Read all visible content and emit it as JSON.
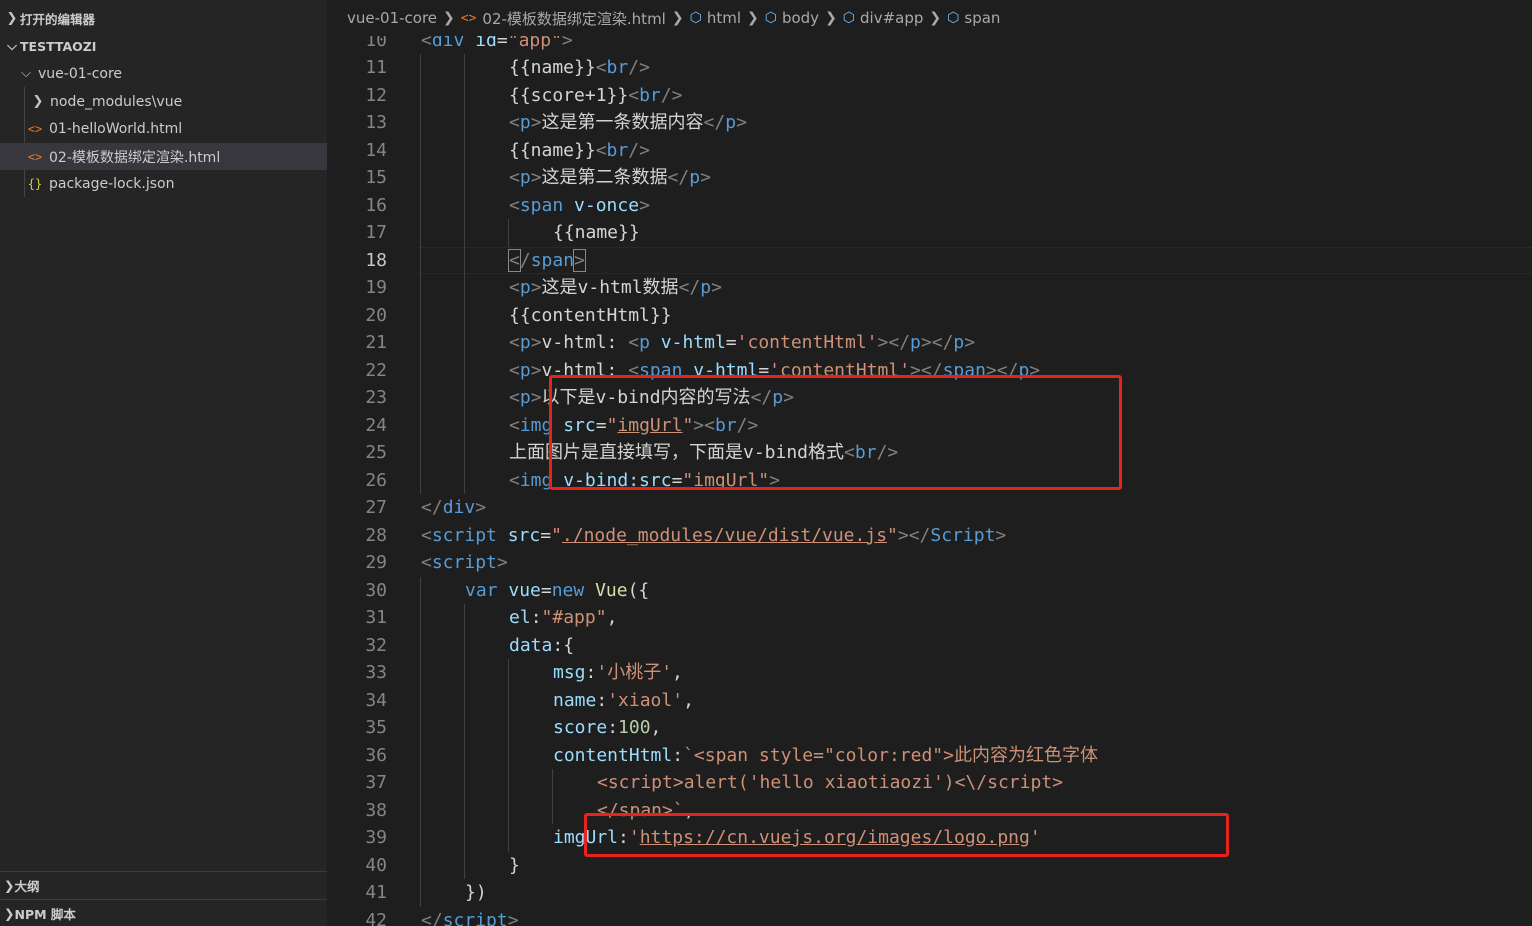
{
  "sidebar": {
    "open_editors": "打开的编辑器",
    "project": "TESTTAOZI",
    "folder": "vue-01-core",
    "items": [
      {
        "label": "node_modules\\vue",
        "type": "folder"
      },
      {
        "label": "01-helloWorld.html",
        "type": "html"
      },
      {
        "label": "02-模板数据绑定渲染.html",
        "type": "html"
      },
      {
        "label": "package-lock.json",
        "type": "json"
      }
    ],
    "outline": "大纲",
    "npm": "NPM 脚本"
  },
  "breadcrumb": {
    "items": [
      "vue-01-core",
      "02-模板数据绑定渲染.html",
      "html",
      "body",
      "div#app",
      "span"
    ]
  },
  "editor": {
    "active_line": 18,
    "lines": [
      {
        "n": 10,
        "indent": 1,
        "tokens": [
          [
            "br",
            "<"
          ],
          [
            "tag",
            "div"
          ],
          [
            "txt",
            " "
          ],
          [
            "attr",
            "id"
          ],
          [
            "txt",
            "="
          ],
          [
            "str",
            "\"app\""
          ],
          [
            "br",
            ">"
          ]
        ]
      },
      {
        "n": 11,
        "indent": 3,
        "tokens": [
          [
            "txt",
            "{{name}}"
          ],
          [
            "br",
            "<"
          ],
          [
            "tag",
            "br"
          ],
          [
            "br",
            "/>"
          ]
        ]
      },
      {
        "n": 12,
        "indent": 3,
        "tokens": [
          [
            "txt",
            "{{score+1}}"
          ],
          [
            "br",
            "<"
          ],
          [
            "tag",
            "br"
          ],
          [
            "br",
            "/>"
          ]
        ]
      },
      {
        "n": 13,
        "indent": 3,
        "tokens": [
          [
            "br",
            "<"
          ],
          [
            "tag",
            "p"
          ],
          [
            "br",
            ">"
          ],
          [
            "txt",
            "这是第一条数据内容"
          ],
          [
            "br",
            "</"
          ],
          [
            "tag",
            "p"
          ],
          [
            "br",
            ">"
          ]
        ]
      },
      {
        "n": 14,
        "indent": 3,
        "tokens": [
          [
            "txt",
            "{{name}}"
          ],
          [
            "br",
            "<"
          ],
          [
            "tag",
            "br"
          ],
          [
            "br",
            "/>"
          ]
        ]
      },
      {
        "n": 15,
        "indent": 3,
        "tokens": [
          [
            "br",
            "<"
          ],
          [
            "tag",
            "p"
          ],
          [
            "br",
            ">"
          ],
          [
            "txt",
            "这是第二条数据"
          ],
          [
            "br",
            "</"
          ],
          [
            "tag",
            "p"
          ],
          [
            "br",
            ">"
          ]
        ]
      },
      {
        "n": 16,
        "indent": 3,
        "tokens": [
          [
            "br",
            "<"
          ],
          [
            "tag",
            "span"
          ],
          [
            "txt",
            " "
          ],
          [
            "attr",
            "v-once"
          ],
          [
            "br",
            ">"
          ]
        ]
      },
      {
        "n": 17,
        "indent": 4,
        "tokens": [
          [
            "txt",
            "{{name}}"
          ]
        ]
      },
      {
        "n": 18,
        "indent": 3,
        "tokens": [
          [
            "brm",
            "<"
          ],
          [
            "br",
            "/"
          ],
          [
            "tag",
            "span"
          ],
          [
            "brm",
            ">"
          ]
        ]
      },
      {
        "n": 19,
        "indent": 3,
        "tokens": [
          [
            "br",
            "<"
          ],
          [
            "tag",
            "p"
          ],
          [
            "br",
            ">"
          ],
          [
            "txt",
            "这是v-html数据"
          ],
          [
            "br",
            "</"
          ],
          [
            "tag",
            "p"
          ],
          [
            "br",
            ">"
          ]
        ]
      },
      {
        "n": 20,
        "indent": 3,
        "tokens": [
          [
            "txt",
            "{{contentHtml}}"
          ]
        ]
      },
      {
        "n": 21,
        "indent": 3,
        "tokens": [
          [
            "br",
            "<"
          ],
          [
            "tag",
            "p"
          ],
          [
            "br",
            ">"
          ],
          [
            "txt",
            "v-html: "
          ],
          [
            "br",
            "<"
          ],
          [
            "tag",
            "p"
          ],
          [
            "txt",
            " "
          ],
          [
            "attr",
            "v-html"
          ],
          [
            "txt",
            "="
          ],
          [
            "str",
            "'contentHtml'"
          ],
          [
            "br",
            "></"
          ],
          [
            "tag",
            "p"
          ],
          [
            "br",
            "></"
          ],
          [
            "tag",
            "p"
          ],
          [
            "br",
            ">"
          ]
        ]
      },
      {
        "n": 22,
        "indent": 3,
        "tokens": [
          [
            "br",
            "<"
          ],
          [
            "tag",
            "p"
          ],
          [
            "br",
            ">"
          ],
          [
            "txt",
            "v-html: "
          ],
          [
            "br",
            "<"
          ],
          [
            "tag",
            "span"
          ],
          [
            "txt",
            " "
          ],
          [
            "attr",
            "v-html"
          ],
          [
            "txt",
            "="
          ],
          [
            "str",
            "'contentHtml'"
          ],
          [
            "br",
            "></"
          ],
          [
            "tag",
            "span"
          ],
          [
            "br",
            "></"
          ],
          [
            "tag",
            "p"
          ],
          [
            "br",
            ">"
          ]
        ]
      },
      {
        "n": 23,
        "indent": 3,
        "tokens": [
          [
            "br",
            "<"
          ],
          [
            "tag",
            "p"
          ],
          [
            "br",
            ">"
          ],
          [
            "txt",
            "以下是v-bind内容的写法"
          ],
          [
            "br",
            "</"
          ],
          [
            "tag",
            "p"
          ],
          [
            "br",
            ">"
          ]
        ]
      },
      {
        "n": 24,
        "indent": 3,
        "tokens": [
          [
            "br",
            "<"
          ],
          [
            "tag",
            "img"
          ],
          [
            "txt",
            " "
          ],
          [
            "attr",
            "src"
          ],
          [
            "txt",
            "="
          ],
          [
            "str",
            "\""
          ],
          [
            "strul",
            "imgUrl"
          ],
          [
            "str",
            "\""
          ],
          [
            "br",
            "><"
          ],
          [
            "tag",
            "br"
          ],
          [
            "br",
            "/>"
          ]
        ]
      },
      {
        "n": 25,
        "indent": 3,
        "tokens": [
          [
            "txt",
            "上面图片是直接填写，下面是v-bind格式"
          ],
          [
            "br",
            "<"
          ],
          [
            "tag",
            "br"
          ],
          [
            "br",
            "/>"
          ]
        ]
      },
      {
        "n": 26,
        "indent": 3,
        "tokens": [
          [
            "br",
            "<"
          ],
          [
            "tag",
            "img"
          ],
          [
            "txt",
            " "
          ],
          [
            "attr",
            "v-bind:src"
          ],
          [
            "txt",
            "="
          ],
          [
            "str",
            "\"imgUrl\""
          ],
          [
            "br",
            ">"
          ]
        ]
      },
      {
        "n": 27,
        "indent": 1,
        "tokens": [
          [
            "br",
            "</"
          ],
          [
            "tag",
            "div"
          ],
          [
            "br",
            ">"
          ]
        ]
      },
      {
        "n": 28,
        "indent": 1,
        "tokens": [
          [
            "br",
            "<"
          ],
          [
            "tag",
            "script"
          ],
          [
            "txt",
            " "
          ],
          [
            "attr",
            "src"
          ],
          [
            "txt",
            "="
          ],
          [
            "str",
            "\""
          ],
          [
            "strul",
            "./node_modules/vue/dist/vue.js"
          ],
          [
            "str",
            "\""
          ],
          [
            "br",
            "></"
          ],
          [
            "tag",
            "Script"
          ],
          [
            "br",
            ">"
          ]
        ]
      },
      {
        "n": 29,
        "indent": 1,
        "tokens": [
          [
            "br",
            "<"
          ],
          [
            "tag",
            "script"
          ],
          [
            "br",
            ">"
          ]
        ]
      },
      {
        "n": 30,
        "indent": 2,
        "tokens": [
          [
            "kw",
            "var"
          ],
          [
            "txt",
            " "
          ],
          [
            "attr",
            "vue"
          ],
          [
            "txt",
            "="
          ],
          [
            "kw",
            "new"
          ],
          [
            "txt",
            " "
          ],
          [
            "fn",
            "Vue"
          ],
          [
            "txt",
            "({"
          ]
        ]
      },
      {
        "n": 31,
        "indent": 3,
        "tokens": [
          [
            "attr",
            "el"
          ],
          [
            "txt",
            ":"
          ],
          [
            "str",
            "\"#app\""
          ],
          [
            "txt",
            ","
          ]
        ]
      },
      {
        "n": 32,
        "indent": 3,
        "tokens": [
          [
            "attr",
            "data"
          ],
          [
            "txt",
            ":{"
          ]
        ]
      },
      {
        "n": 33,
        "indent": 4,
        "tokens": [
          [
            "attr",
            "msg"
          ],
          [
            "txt",
            ":"
          ],
          [
            "str",
            "'小桃子'"
          ],
          [
            "txt",
            ","
          ]
        ]
      },
      {
        "n": 34,
        "indent": 4,
        "tokens": [
          [
            "attr",
            "name"
          ],
          [
            "txt",
            ":"
          ],
          [
            "str",
            "'xiaol'"
          ],
          [
            "txt",
            ","
          ]
        ]
      },
      {
        "n": 35,
        "indent": 4,
        "tokens": [
          [
            "attr",
            "score"
          ],
          [
            "txt",
            ":"
          ],
          [
            "num",
            "100"
          ],
          [
            "txt",
            ","
          ]
        ]
      },
      {
        "n": 36,
        "indent": 4,
        "tokens": [
          [
            "attr",
            "contentHtml"
          ],
          [
            "txt",
            ":"
          ],
          [
            "str",
            "`<span style=\"color:red\">此内容为红色字体"
          ]
        ]
      },
      {
        "n": 37,
        "indent": 5,
        "tokens": [
          [
            "str",
            "<script>alert('hello xiaotiaozi')<\\/script>"
          ]
        ]
      },
      {
        "n": 38,
        "indent": 5,
        "tokens": [
          [
            "str",
            "</span>`"
          ],
          [
            "txt",
            ","
          ]
        ]
      },
      {
        "n": 39,
        "indent": 4,
        "tokens": [
          [
            "attr",
            "imgUrl"
          ],
          [
            "txt",
            ":"
          ],
          [
            "str",
            "'"
          ],
          [
            "strul",
            "https://cn.vuejs.org/images/logo.png"
          ],
          [
            "str",
            "'"
          ]
        ]
      },
      {
        "n": 40,
        "indent": 3,
        "tokens": [
          [
            "txt",
            "}"
          ]
        ]
      },
      {
        "n": 41,
        "indent": 2,
        "tokens": [
          [
            "txt",
            "})"
          ]
        ]
      },
      {
        "n": 42,
        "indent": 1,
        "tokens": [
          [
            "br",
            "</"
          ],
          [
            "tag",
            "script"
          ],
          [
            "br",
            ">"
          ]
        ]
      }
    ]
  }
}
